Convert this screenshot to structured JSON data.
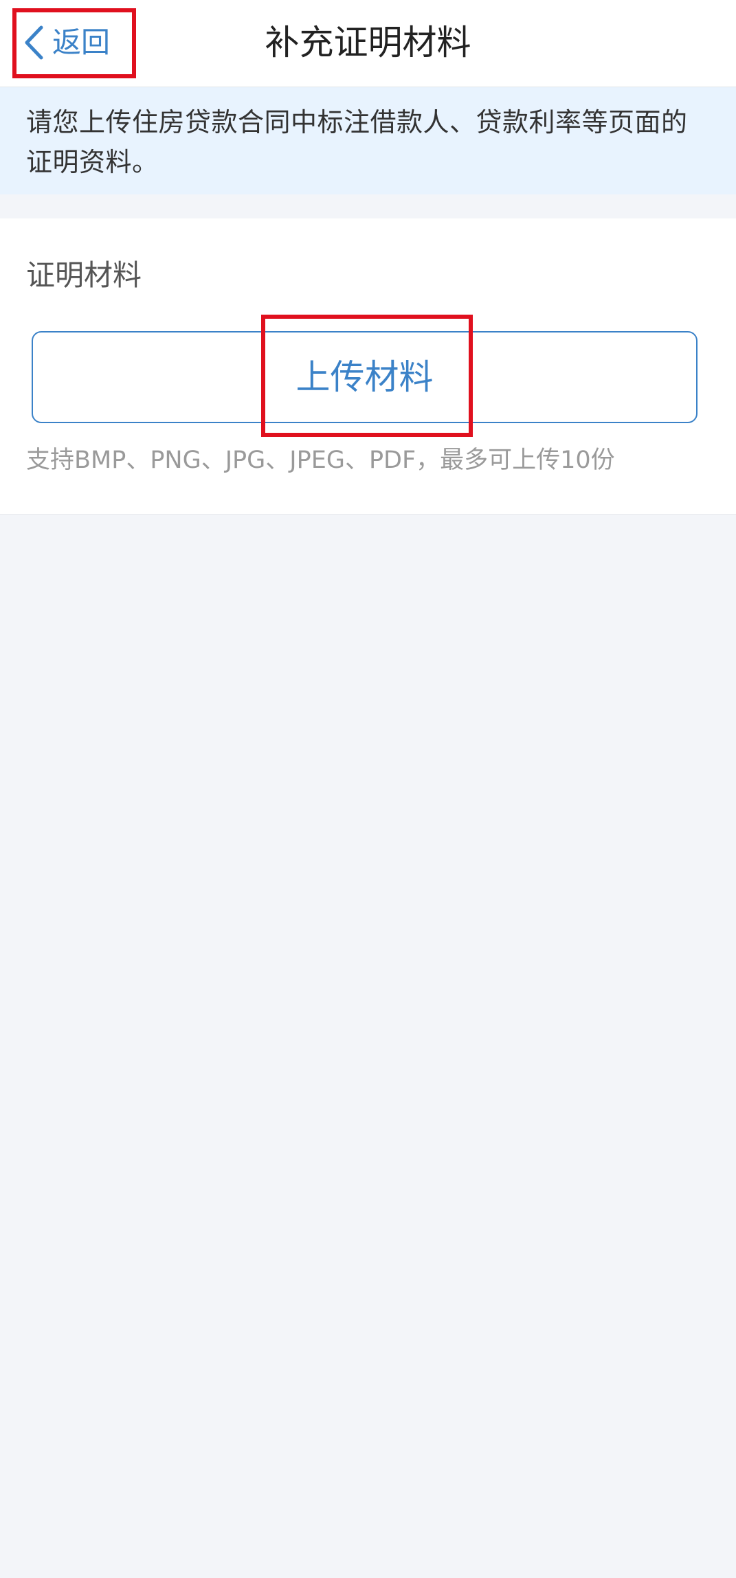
{
  "nav": {
    "back_label": "返回",
    "back_icon": "chevron-left-icon",
    "title": "补充证明材料"
  },
  "notice": {
    "text": "请您上传住房贷款合同中标注借款人、贷款利率等页面的证明资料。"
  },
  "materials": {
    "section_label": "证明材料",
    "upload_label": "上传材料",
    "hint": "支持BMP、PNG、JPG、JPEG、PDF，最多可上传10份"
  },
  "colors": {
    "accent": "#3b82c8",
    "highlight": "#e0101e",
    "notice_bg": "#e8f3fe",
    "page_bg": "#f3f5f9"
  }
}
